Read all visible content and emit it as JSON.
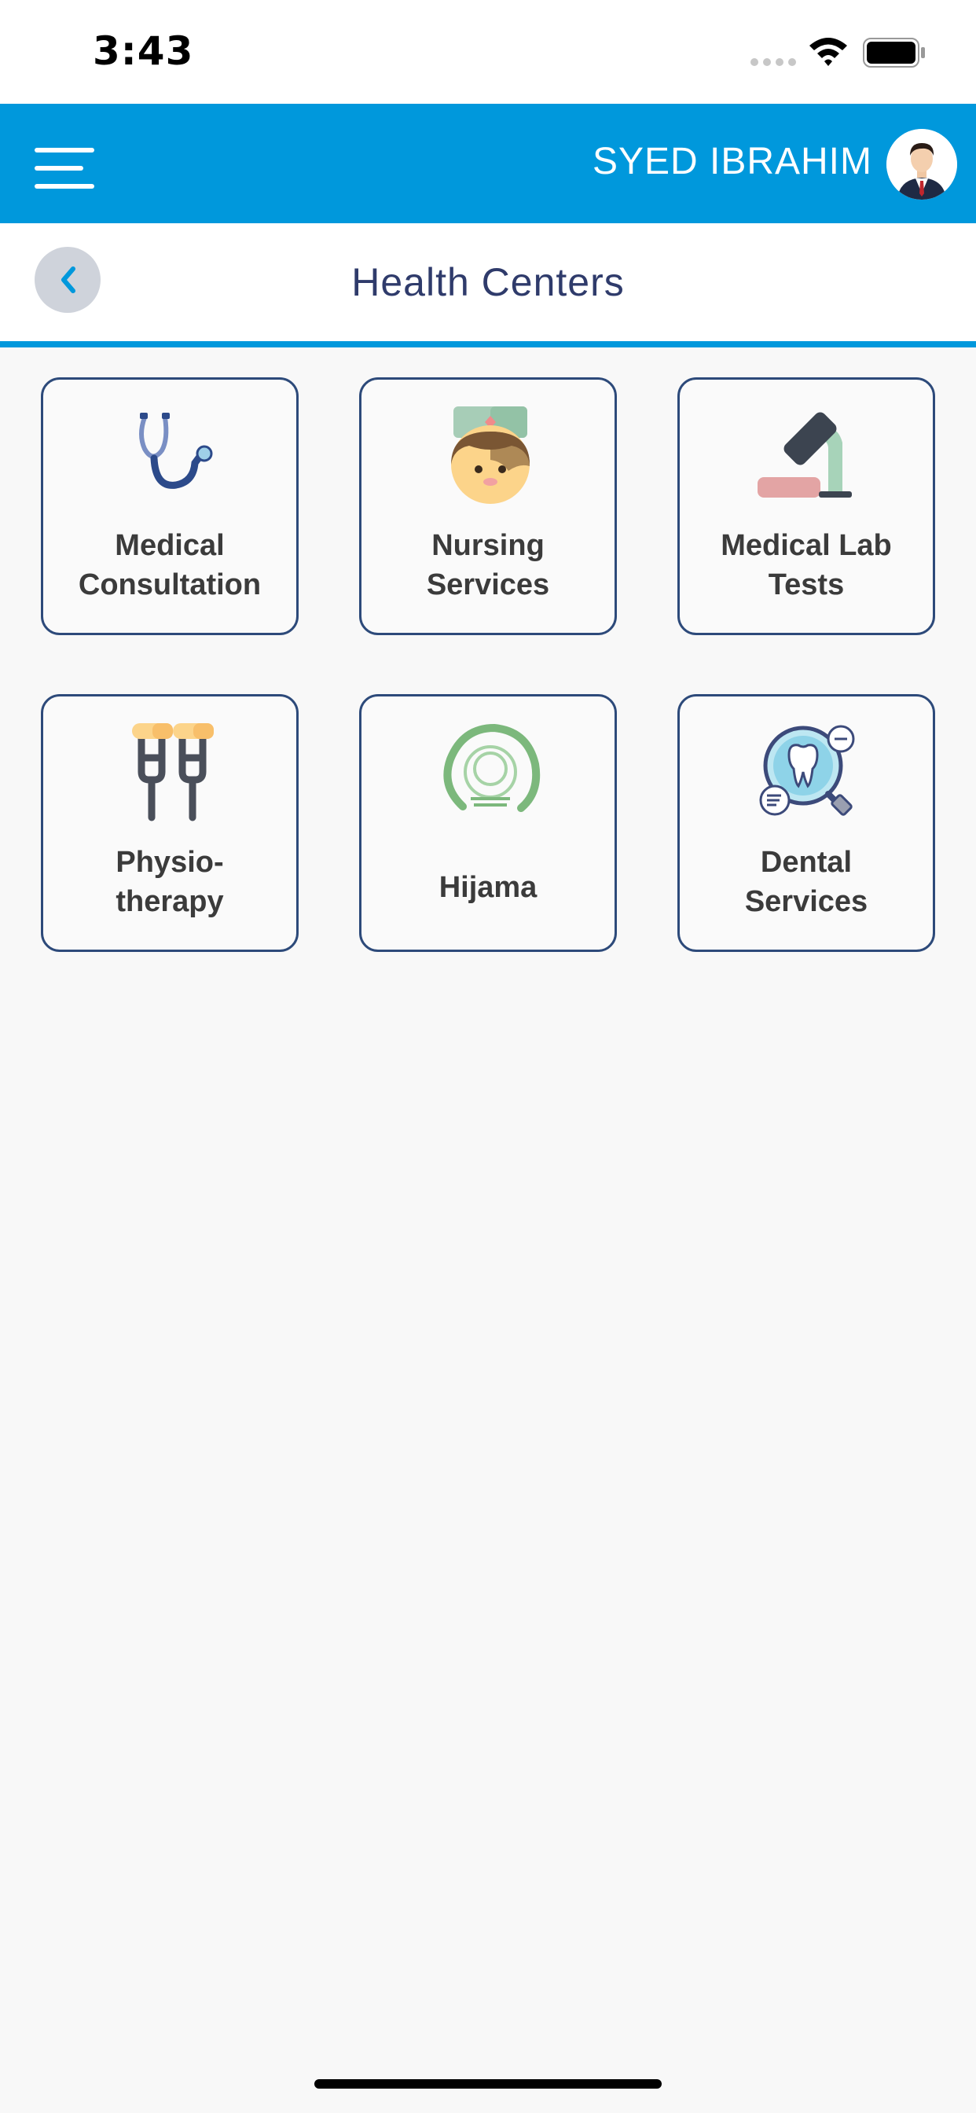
{
  "status_bar": {
    "time": "3:43"
  },
  "header": {
    "user_name": "SYED IBRAHIM"
  },
  "sub_header": {
    "title": "Health Centers"
  },
  "services": [
    {
      "line1": "Medical",
      "line2": "Consultation",
      "icon": "stethoscope-icon"
    },
    {
      "line1": "Nursing",
      "line2": "Services",
      "icon": "nurse-icon"
    },
    {
      "line1": "Medical Lab",
      "line2": "Tests",
      "icon": "microscope-icon"
    },
    {
      "line1": "Physio-",
      "line2": "therapy",
      "icon": "crutches-icon"
    },
    {
      "line1": "Hijama",
      "line2": "",
      "icon": "hijama-cup-icon"
    },
    {
      "line1": "Dental",
      "line2": "Services",
      "icon": "dental-magnifier-icon"
    }
  ],
  "colors": {
    "primary": "#0098dc",
    "card_border": "#2d4a7a",
    "title": "#2f3b6b"
  }
}
